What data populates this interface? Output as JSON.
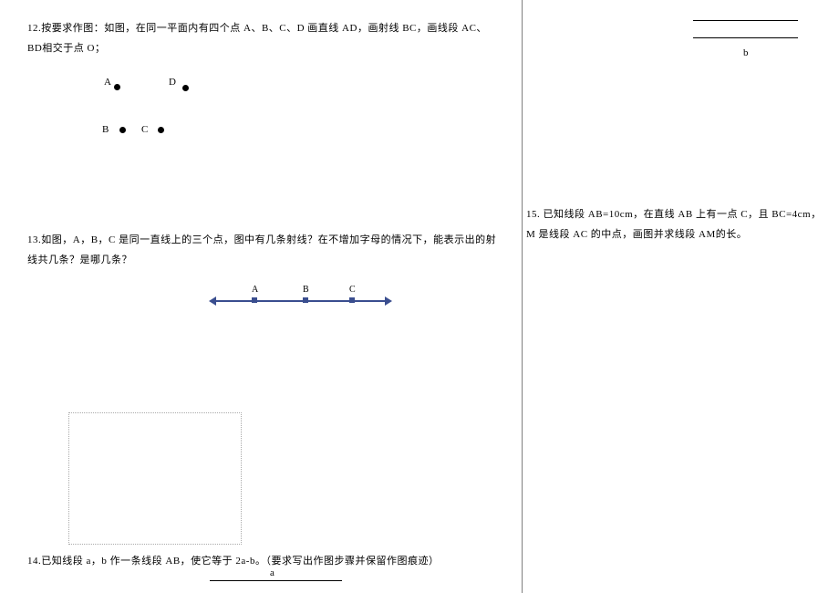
{
  "problems": {
    "p12": {
      "text": "12.按要求作图：如图，在同一平面内有四个点 A、B、C、D 画直线 AD，画射线 BC，画线段 AC、BD相交于点 O；",
      "labels": {
        "A": "A",
        "B": "B",
        "C": "C",
        "D": "D"
      }
    },
    "p13": {
      "text": "13.如图，A，B，C 是同一直线上的三个点，图中有几条射线？在不增加字母的情况下，能表示出的射线共几条？是哪几条？",
      "labels": {
        "A": "A",
        "B": "B",
        "C": "C"
      }
    },
    "p14": {
      "text": "14.已知线段 a，b 作一条线段 AB，使它等于 2a-b。（要求写出作图步骤并保留作图痕迹）",
      "label_a": "a",
      "label_b": "b"
    },
    "p15": {
      "text": "15. 已知线段 AB=10cm，在直线 AB 上有一点 C，且 BC=4cm，M 是线段 AC 的中点，画图并求线段 AM的长。"
    }
  }
}
